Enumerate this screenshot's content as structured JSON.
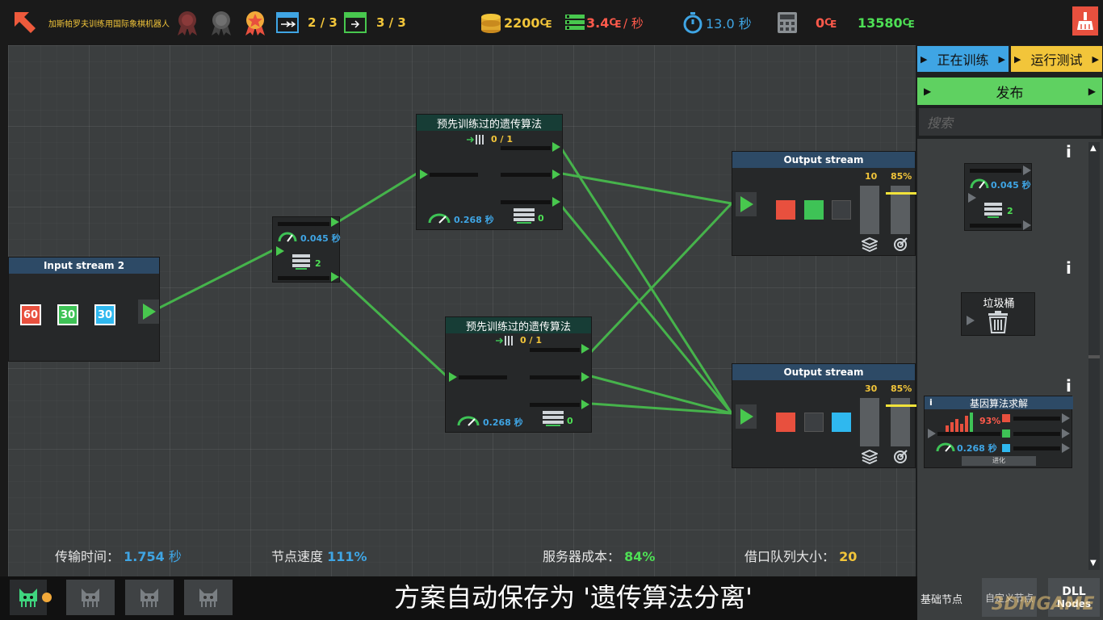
{
  "topbar": {
    "title": "加斯帕罗夫训练用国际象棋机器人",
    "counter1": "2 / 3",
    "counter2": "3 / 3",
    "coins": "2200₠",
    "rate_value": "3.4₠",
    "rate_unit": "/ 秒",
    "timer": "13.0 秒",
    "cost": "0₠",
    "total": "13580₠"
  },
  "canvas": {
    "input_stream": {
      "title": "Input stream 2",
      "values": [
        "60",
        "30",
        "30"
      ]
    },
    "speed_node": {
      "time": "0.045 秒",
      "count": "2"
    },
    "ga_node_top": {
      "title": "预先训练过的遗传算法",
      "ratio": "0 / 1",
      "time": "0.268 秒",
      "count": "0"
    },
    "ga_node_bottom": {
      "title": "预先训练过的遗传算法",
      "ratio": "0 / 1",
      "time": "0.268 秒",
      "count": "0"
    },
    "output_top": {
      "title": "Output stream",
      "count": "10",
      "percent": "85%"
    },
    "output_bottom": {
      "title": "Output stream",
      "count": "30",
      "percent": "85%"
    }
  },
  "stats": {
    "transfer_label": "传输时间：",
    "transfer_value": "1.754",
    "transfer_unit": "秒",
    "node_speed_label": "节点速度",
    "node_speed_value": "111%",
    "server_cost_label": "服务器成本：",
    "server_cost_value": "84%",
    "queue_label": "借口队列大小：",
    "queue_value": "20"
  },
  "sidebar": {
    "train_button": "正在训练",
    "test_button": "运行测试",
    "publish_button": "发布",
    "search_placeholder": "搜索",
    "speed_card": {
      "time": "0.045 秒",
      "count": "2"
    },
    "trash_label": "垃圾桶",
    "ga_solver": {
      "title": "基因算法求解",
      "percent": "93%",
      "time": "0.268 秒",
      "evolve": "进化"
    },
    "tab_basic": "基础节点",
    "tab_custom": "自定义节点",
    "tab_dll_line1": "DLL",
    "tab_dll_line2": "Nodes"
  },
  "subtitle": "方案自动保存为 '遗传算法分离'",
  "watermark": "3DMGAME",
  "colors": {
    "wire": "#48c84e",
    "red": "#e8503e",
    "green": "#3ec356",
    "blue": "#2fb8ef",
    "yellow": "#f2c53a"
  }
}
